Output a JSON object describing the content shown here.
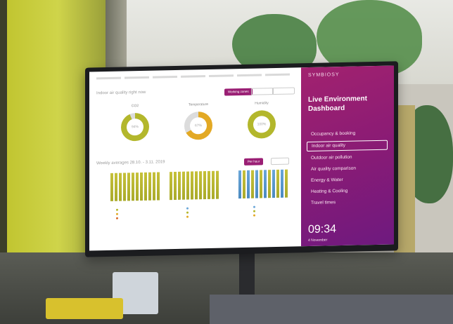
{
  "screen": {
    "nav": {
      "title": "Indoor air quality right now"
    },
    "top_buttons": [
      "Working zones"
    ],
    "gauges": [
      {
        "label": "CO2",
        "value": "94%",
        "color": "#b3b72c",
        "fraction": 0.94
      },
      {
        "label": "Temperature",
        "value": "67%",
        "color": "#e3a924",
        "fraction": 0.67
      },
      {
        "label": "Humidity",
        "value": "100%",
        "color": "#b3b72c",
        "fraction": 1.0
      }
    ],
    "weekly": {
      "title": "Weekly averages",
      "range": "28.10. - 3.11. 2019",
      "toggle_on": "Per hour"
    }
  },
  "panel": {
    "brand": "SYMBIOSY",
    "title": "Live Environment Dashboard",
    "menu": [
      "Occupancy & booking",
      "Indoor air quality",
      "Outdoor air pollution",
      "Air quality comparison",
      "Energy & Water",
      "Heating & Cooling",
      "Travel times"
    ],
    "active_index": 1,
    "time": "09:34",
    "date": "4 November"
  }
}
